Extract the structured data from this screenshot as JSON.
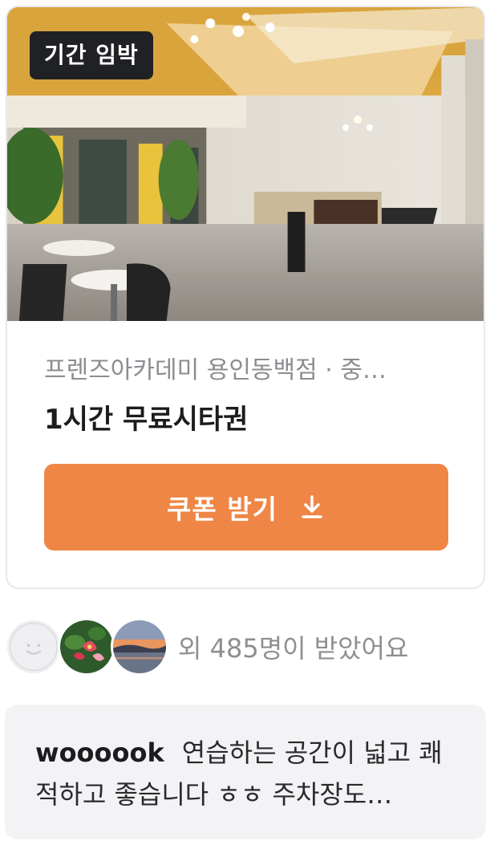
{
  "coupon": {
    "badge": "기간 임박",
    "store_name": "프렌즈아카데미 용인동백점 · 중…",
    "title": "1시간 무료시타권",
    "button_label": "쿠폰 받기",
    "button_color": "#ef8645"
  },
  "receivers": {
    "text": "외 485명이 받았어요",
    "avatars": [
      "default-avatar",
      "flower-photo-avatar",
      "sunset-photo-avatar"
    ]
  },
  "review": {
    "username": "woooook",
    "text": "연습하는 공간이 넓고 쾌적하고 좋습니다 ㅎㅎ 주차장도…"
  },
  "icons": {
    "download": "download-icon"
  }
}
